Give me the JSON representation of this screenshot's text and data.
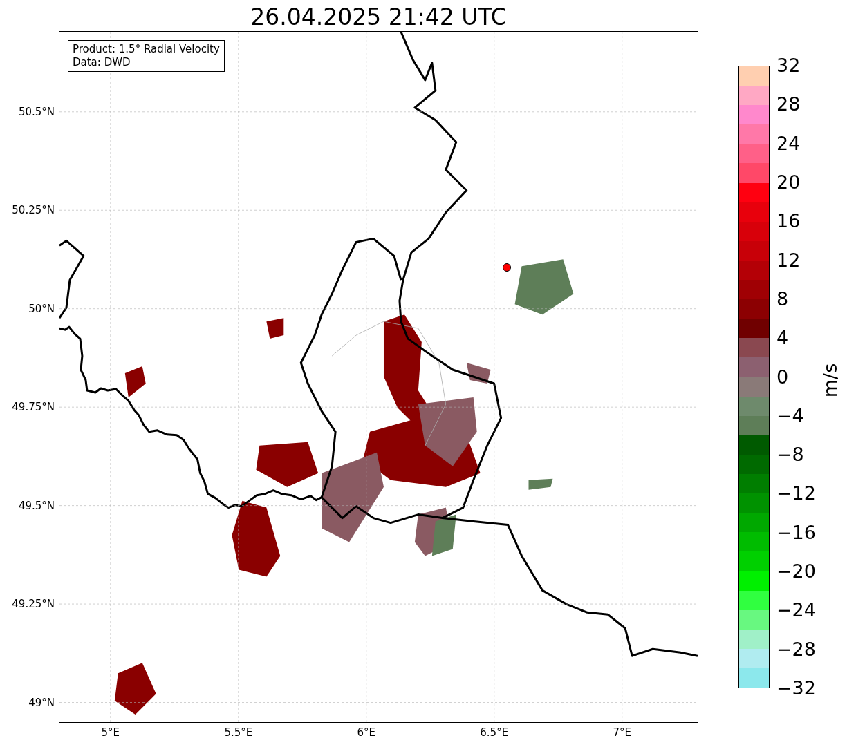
{
  "title": "26.04.2025 21:42 UTC",
  "info_box": [
    "Product: 1.5° Radial Velocity",
    "Data: DWD"
  ],
  "axes": {
    "xticks": [
      "5°E",
      "5.5°E",
      "6°E",
      "6.5°E",
      "7°E"
    ],
    "yticks": [
      "50.5°N",
      "50.25°N",
      "50°N",
      "49.75°N",
      "49.5°N",
      "49.25°N",
      "49°N"
    ]
  },
  "colorbar": {
    "label": "m/s",
    "ticks": [
      "32",
      "28",
      "24",
      "20",
      "16",
      "12",
      "8",
      "4",
      "0",
      "−4",
      "−8",
      "−12",
      "−16",
      "−20",
      "−24",
      "−28",
      "−32"
    ]
  }
}
